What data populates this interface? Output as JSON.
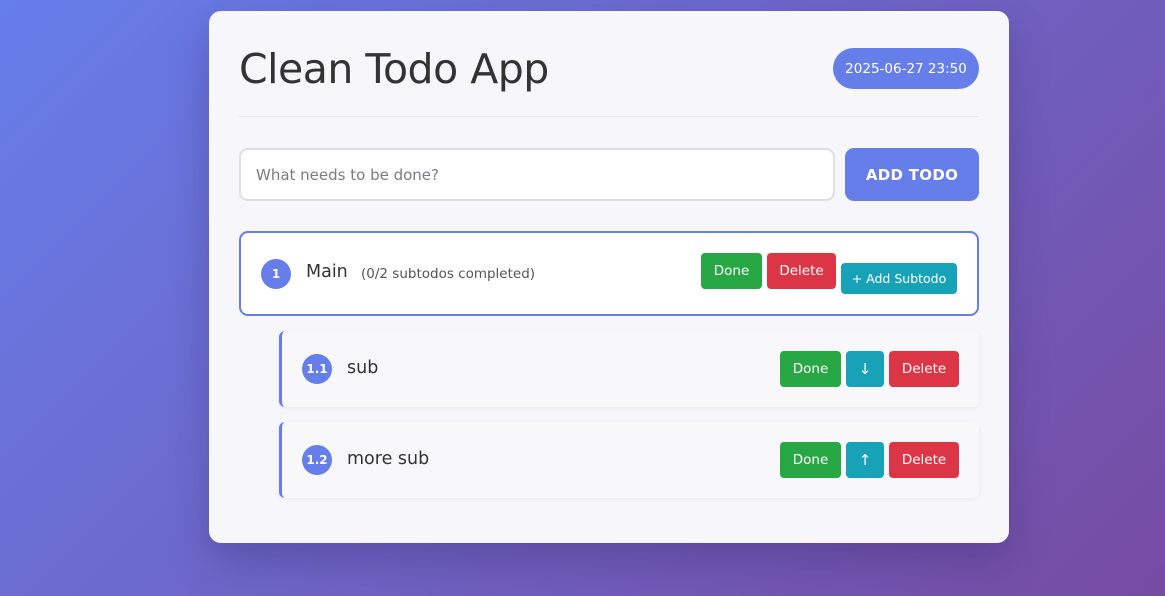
{
  "header": {
    "title": "Clean Todo App",
    "datetime": "2025-06-27 23:50"
  },
  "input": {
    "value": "",
    "placeholder": "What needs to be done?"
  },
  "add_button_label": "ADD TODO",
  "todos": [
    {
      "number": "1",
      "label": "Main",
      "progress": "(0/2 subtodos completed)",
      "done_label": "Done",
      "delete_label": "Delete",
      "add_subtodo_label": "+ Add Subtodo",
      "subtodos": [
        {
          "number": "1.1",
          "label": "sub",
          "done_label": "Done",
          "move_label": "↓",
          "delete_label": "Delete"
        },
        {
          "number": "1.2",
          "label": "more sub",
          "done_label": "Done",
          "move_label": "↑",
          "delete_label": "Delete"
        }
      ]
    }
  ],
  "colors": {
    "accent": "#667eea",
    "done": "#28a745",
    "delete": "#dc3545",
    "info": "#17a2b8"
  }
}
